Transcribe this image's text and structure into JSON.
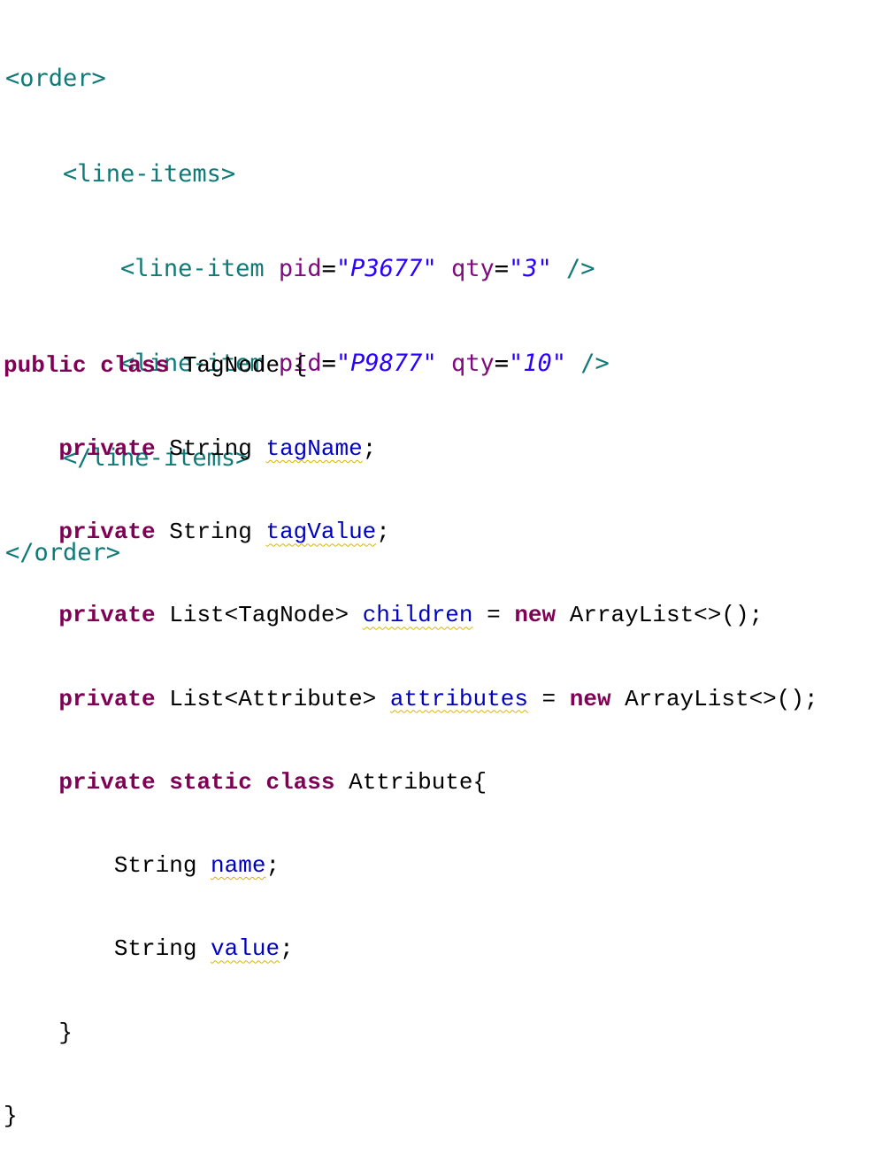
{
  "xml": {
    "l1": "<order>",
    "l2": "<line-items>",
    "l3": {
      "open": "<line-item ",
      "attr1": "pid",
      "eq1": "=",
      "val1": "\"P3677\"",
      "attr2": "qty",
      "eq2": "=",
      "val2": "\"3\"",
      "close": " />"
    },
    "l4": {
      "open": "<line-item ",
      "attr1": "pid",
      "eq1": "=",
      "val1": "\"P9877\"",
      "attr2": "qty",
      "eq2": "=",
      "val2": "\"10\"",
      "close": " />"
    },
    "l5": "</line-items>",
    "l6": "</order>"
  },
  "java": {
    "l1": {
      "kw": "public class",
      "rest": " TagNode {"
    },
    "l2": {
      "kw": "private",
      "type": " String ",
      "field": "tagName",
      "end": ";"
    },
    "l3": {
      "kw": "private",
      "type": " String ",
      "field": "tagValue",
      "end": ";"
    },
    "l4": {
      "kw": "private",
      "type": " List<TagNode> ",
      "field": "children",
      "mid": " = ",
      "kw2": "new",
      "end": " ArrayList<>();"
    },
    "l5": {
      "kw": "private",
      "type": " List<Attribute> ",
      "field": "attributes",
      "mid": " = ",
      "kw2": "new",
      "end": " ArrayList<>();"
    },
    "l6": {
      "kw": "private static class",
      "rest": " Attribute{"
    },
    "l7": {
      "type": "String ",
      "field": "name",
      "end": ";"
    },
    "l8": {
      "type": "String ",
      "field": "value",
      "end": ";"
    },
    "l9": "}",
    "l10": "}"
  },
  "colors": {
    "tag": "#0f7a78",
    "attribute": "#7f0b7f",
    "string_value": "#2a00ff",
    "keyword": "#7f0055",
    "field": "#0000c0",
    "warning_underline": "#d8b400"
  }
}
